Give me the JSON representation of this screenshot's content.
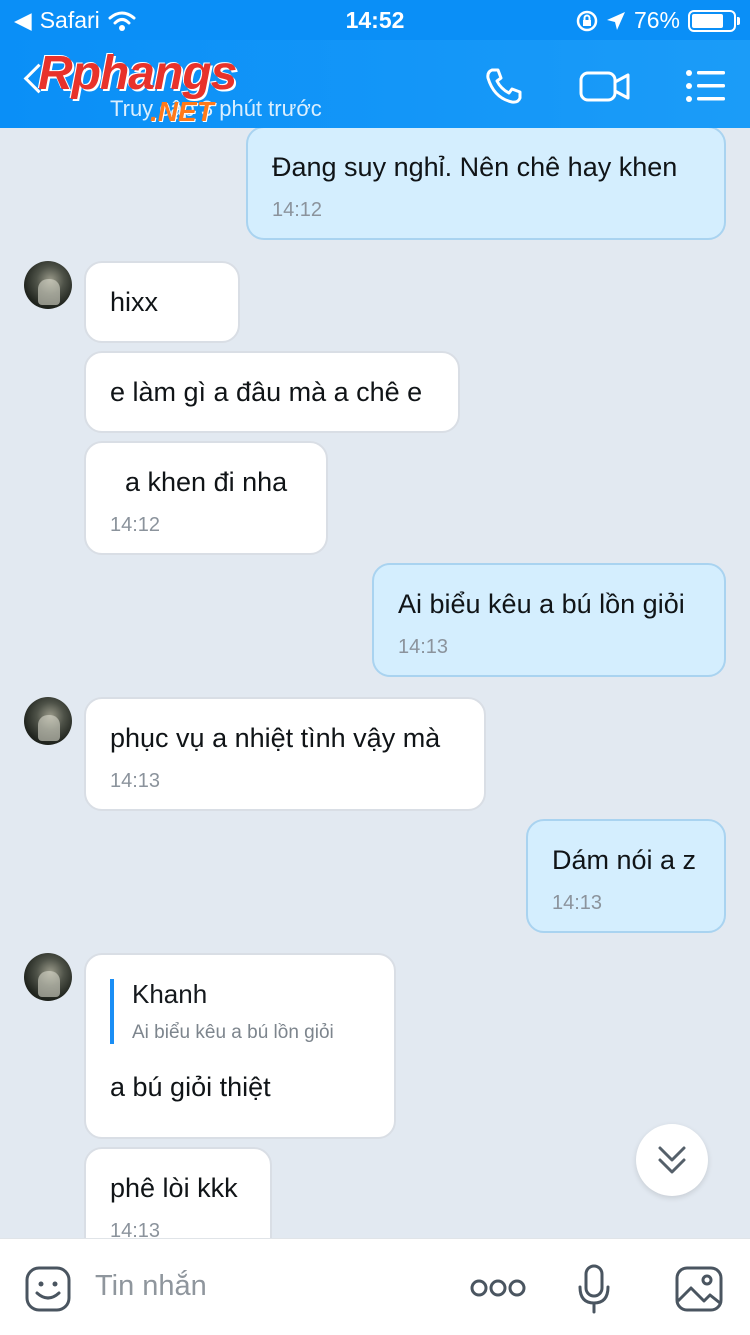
{
  "status_bar": {
    "back_app": "Safari",
    "time": "14:52",
    "battery": "76%"
  },
  "header": {
    "logo_text": "Rphangs",
    "logo_suffix": ".NET",
    "subtitle": "Truy cập 3 phút trước",
    "icons": [
      "phone-icon",
      "video-call-icon",
      "menu-icon"
    ]
  },
  "messages": [
    {
      "from": "me",
      "text": "Đang suy nghỉ. Nên chê hay khen",
      "time": "14:12"
    },
    {
      "from": "them",
      "text": "hixx",
      "time": ""
    },
    {
      "from": "them",
      "text": "e làm gì a đâu mà a chê e",
      "time": ""
    },
    {
      "from": "them",
      "text": "  a khen đi nha",
      "time": "14:12"
    },
    {
      "from": "me",
      "text": "Ai biểu kêu a bú lồn giỏi",
      "time": "14:13"
    },
    {
      "from": "them",
      "text": "phục vụ a nhiệt tình vậy mà",
      "time": "14:13"
    },
    {
      "from": "me",
      "text": "Dám nói a z",
      "time": "14:13"
    },
    {
      "from": "them",
      "text": "a bú giỏi thiệt",
      "time": "",
      "quote": {
        "name": "Khanh",
        "text": "Ai biểu kêu a bú lồn giỏi"
      }
    },
    {
      "from": "them",
      "text": "phê lòi kkk",
      "time": "14:13"
    }
  ],
  "input": {
    "placeholder": "Tin nhắn",
    "icons": [
      "emoji-icon",
      "more-icon",
      "microphone-icon",
      "image-icon"
    ]
  },
  "colors": {
    "header": "#0a8ff7",
    "my_bubble": "#d4eefe",
    "their_bubble": "#ffffff",
    "background": "#e2e9f1"
  }
}
